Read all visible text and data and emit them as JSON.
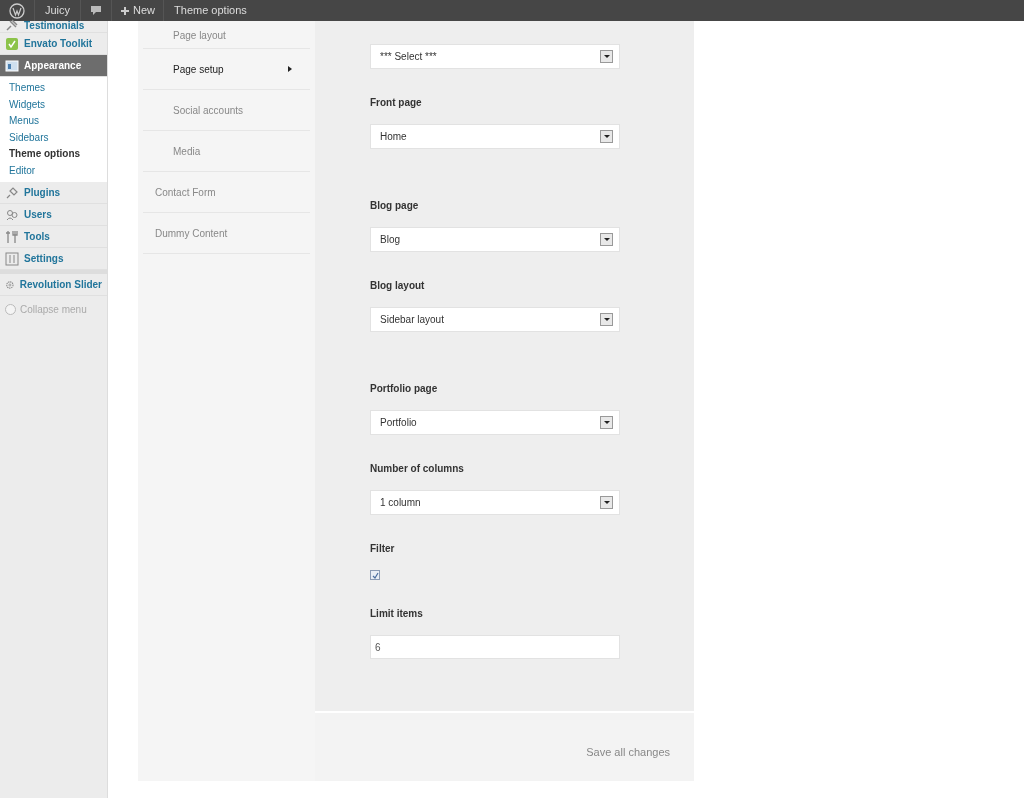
{
  "admin_bar": {
    "site": "Juicy",
    "new_label": "New",
    "page_label": "Theme options"
  },
  "admin_menu": {
    "items": [
      {
        "label": "Testimonials",
        "kind": "pin",
        "selected": false
      },
      {
        "label": "Envato Toolkit",
        "kind": "toolkit",
        "selected": false
      },
      {
        "label": "Appearance",
        "kind": "appearance",
        "selected": true,
        "children": [
          {
            "label": "Themes",
            "selected": false
          },
          {
            "label": "Widgets",
            "selected": false
          },
          {
            "label": "Menus",
            "selected": false
          },
          {
            "label": "Sidebars",
            "selected": false
          },
          {
            "label": "Theme options",
            "selected": true
          },
          {
            "label": "Editor",
            "selected": false
          }
        ]
      },
      {
        "label": "Plugins",
        "kind": "plugins",
        "selected": false
      },
      {
        "label": "Users",
        "kind": "users",
        "selected": false
      },
      {
        "label": "Tools",
        "kind": "tools",
        "selected": false
      },
      {
        "label": "Settings",
        "kind": "settings",
        "selected": false
      },
      {
        "label": "Revolution Slider",
        "kind": "gear",
        "selected": false
      }
    ],
    "collapse_label": "Collapse menu"
  },
  "options_nav": [
    {
      "kind": "subitem",
      "label": "Page layout",
      "selected": false
    },
    {
      "kind": "subitem",
      "label": "Page setup",
      "selected": true
    },
    {
      "kind": "subitem",
      "label": "Social accounts",
      "selected": false
    },
    {
      "kind": "subitem",
      "label": "Media",
      "selected": false
    },
    {
      "kind": "item",
      "label": "Contact Form",
      "selected": false
    },
    {
      "kind": "item",
      "label": "Dummy Content",
      "selected": false
    }
  ],
  "fields": [
    {
      "kind": "select",
      "value": "*** Select ***"
    },
    {
      "kind": "select",
      "label": "Front page",
      "value": "Home"
    },
    {
      "kind": "select",
      "label": "Blog page",
      "value": "Blog"
    },
    {
      "kind": "select",
      "label": "Blog layout",
      "value": "Sidebar layout"
    },
    {
      "kind": "select",
      "label": "Portfolio page",
      "value": "Portfolio"
    },
    {
      "kind": "select",
      "label": "Number of columns",
      "value": "1 column"
    },
    {
      "kind": "checkbox",
      "label": "Filter",
      "checked": true
    },
    {
      "kind": "text",
      "label": "Limit items",
      "value": "6"
    }
  ],
  "save_label": "Save all changes"
}
